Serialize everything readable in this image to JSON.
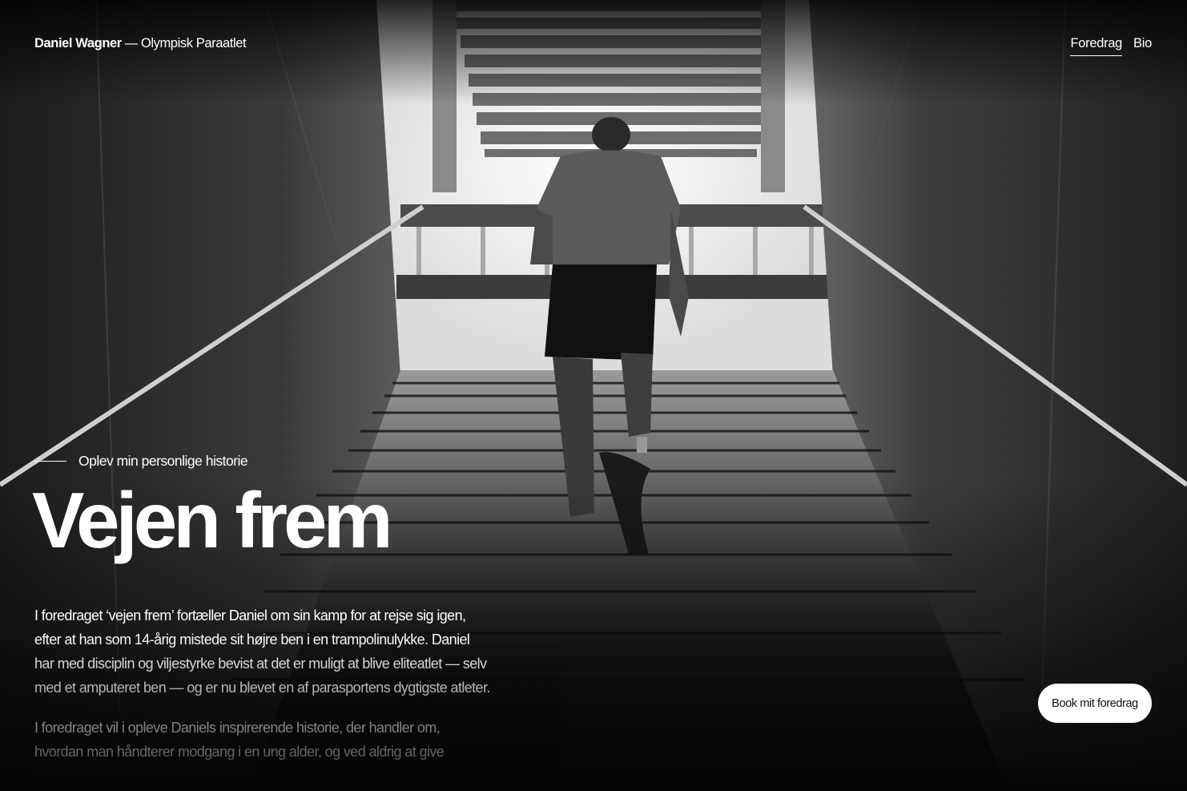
{
  "header": {
    "brand_name": "Daniel Wagner",
    "brand_separator": "—",
    "brand_tagline": "Olympisk Paraatlet"
  },
  "nav": {
    "items": [
      {
        "label": "Foredrag",
        "active": true
      },
      {
        "label": "Bio",
        "active": false
      }
    ]
  },
  "hero": {
    "eyebrow": "Oplev min personlige historie",
    "title": "Vejen frem",
    "paragraphs": [
      "I foredraget ‘vejen frem’ fortæller Daniel om sin kamp for at rejse sig igen, efter at han som 14-årig mistede sit højre ben i en trampolinulykke. Daniel har med disciplin og viljestyrke bevist at det er muligt at blive eliteatlet — selv med et amputeret ben — og er nu blevet en af parasportens dygtigste atleter.",
      "I foredraget vil i opleve Daniels inspirerende historie, der handler om, hvordan man håndterer modgang i en ung alder, og ved aldrig at give"
    ],
    "photo_description_icon": "stairway-runner-photo"
  },
  "cta": {
    "label": "Book mit foredrag"
  },
  "colors": {
    "background": "#050505",
    "text": "#ffffff",
    "cta_background": "#ffffff",
    "cta_text": "#111111"
  }
}
